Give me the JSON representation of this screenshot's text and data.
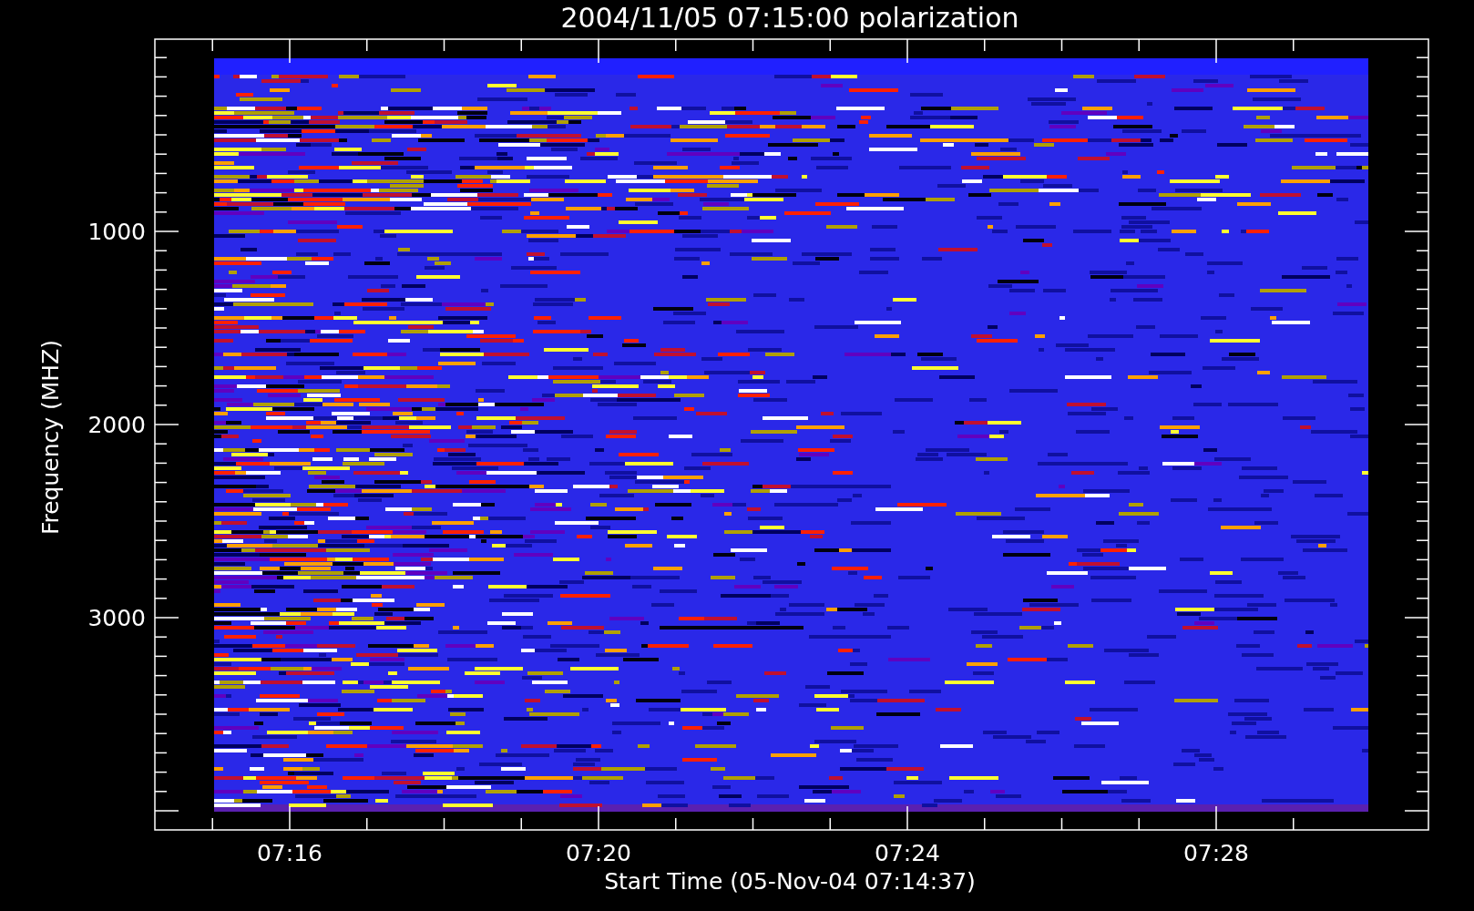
{
  "title": "2004/11/05 07:15:00 polarization",
  "y_axis": {
    "label": "Frequency (MHZ)",
    "ticks": [
      "1000",
      "2000",
      "3000"
    ]
  },
  "x_axis": {
    "label": "Start Time (05-Nov-04 07:14:37)",
    "ticks": [
      "07:16",
      "07:20",
      "07:24",
      "07:28"
    ]
  }
}
